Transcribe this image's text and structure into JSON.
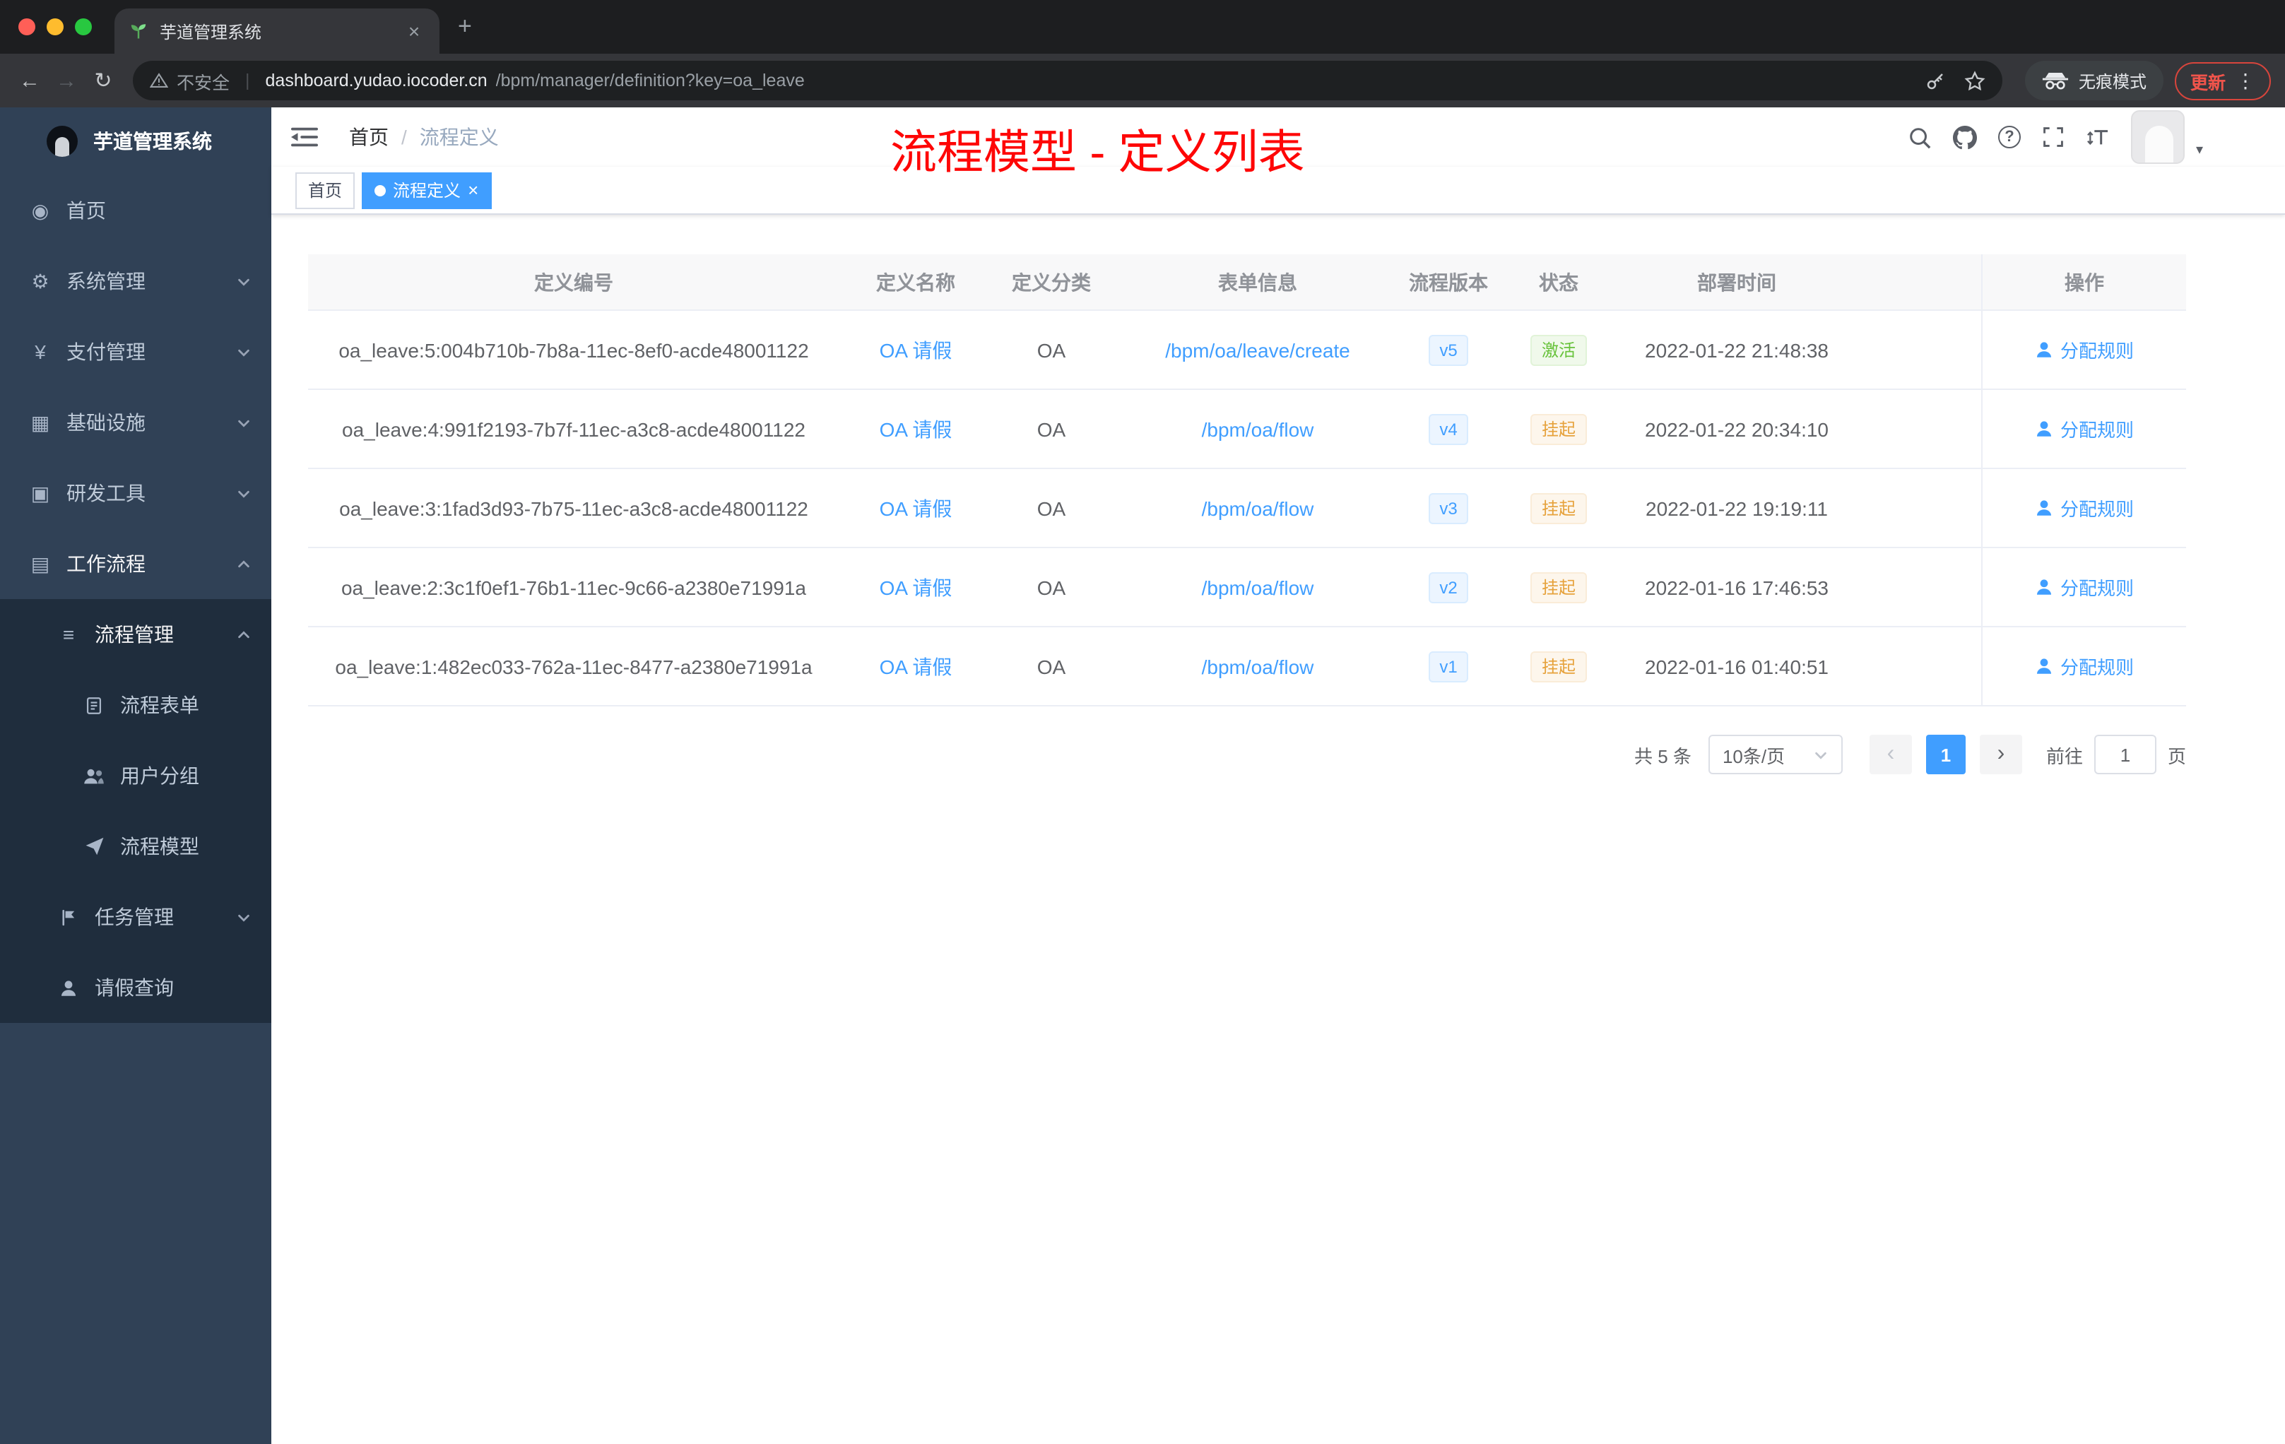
{
  "colors": {
    "accent": "#409eff",
    "success": "#67c23a",
    "warning": "#e6a23c",
    "overlay_red": "#fe0606",
    "sidebar_bg": "#304156",
    "sidebar_sub_bg": "#1f2d3d"
  },
  "browser": {
    "tab_title": "芋道管理系统",
    "security_label": "不安全",
    "url_host": "dashboard.yudao.iocoder.cn",
    "url_path": "/bpm/manager/definition?key=oa_leave",
    "incognito_label": "无痕模式",
    "update_label": "更新"
  },
  "icons": {
    "home": "◉",
    "settings": "⚙",
    "payment": "¥",
    "infrastructure": "▦",
    "devtools": "▣",
    "workflow": "▤",
    "process_mgmt": "≡",
    "close": "×",
    "new_tab": "+",
    "back": "←",
    "forward": "→",
    "reload": "↻",
    "dots": "⋮",
    "url_divider": "|",
    "caret_down": "▾",
    "help": "?",
    "prev": "‹",
    "next": "›"
  },
  "sidebar": {
    "logo_title": "芋道管理系统",
    "items": [
      {
        "label": "首页"
      },
      {
        "label": "系统管理"
      },
      {
        "label": "支付管理"
      },
      {
        "label": "基础设施"
      },
      {
        "label": "研发工具"
      },
      {
        "label": "工作流程"
      },
      {
        "label": "流程管理"
      },
      {
        "label": "流程表单"
      },
      {
        "label": "用户分组"
      },
      {
        "label": "流程模型"
      },
      {
        "label": "任务管理"
      },
      {
        "label": "请假查询"
      }
    ]
  },
  "header": {
    "breadcrumb_home": "首页",
    "breadcrumb_separator": "/",
    "breadcrumb_current": "流程定义",
    "overlay_title": "流程模型 - 定义列表"
  },
  "tags": [
    {
      "label": "首页"
    },
    {
      "label": "流程定义"
    }
  ],
  "table": {
    "columns": [
      "定义编号",
      "定义名称",
      "定义分类",
      "表单信息",
      "流程版本",
      "状态",
      "部署时间",
      "操作"
    ],
    "rows": [
      {
        "id": "oa_leave:5:004b710b-7b8a-11ec-8ef0-acde48001122",
        "name": "OA 请假",
        "category": "OA",
        "form": "/bpm/oa/leave/create",
        "version": "v5",
        "status": "激活",
        "status_type": "success",
        "time": "2022-01-22 21:48:38",
        "action": "分配规则"
      },
      {
        "id": "oa_leave:4:991f2193-7b7f-11ec-a3c8-acde48001122",
        "name": "OA 请假",
        "category": "OA",
        "form": "/bpm/oa/flow",
        "version": "v4",
        "status": "挂起",
        "status_type": "warning",
        "time": "2022-01-22 20:34:10",
        "action": "分配规则"
      },
      {
        "id": "oa_leave:3:1fad3d93-7b75-11ec-a3c8-acde48001122",
        "name": "OA 请假",
        "category": "OA",
        "form": "/bpm/oa/flow",
        "version": "v3",
        "status": "挂起",
        "status_type": "warning",
        "time": "2022-01-22 19:19:11",
        "action": "分配规则"
      },
      {
        "id": "oa_leave:2:3c1f0ef1-76b1-11ec-9c66-a2380e71991a",
        "name": "OA 请假",
        "category": "OA",
        "form": "/bpm/oa/flow",
        "version": "v2",
        "status": "挂起",
        "status_type": "warning",
        "time": "2022-01-16 17:46:53",
        "action": "分配规则"
      },
      {
        "id": "oa_leave:1:482ec033-762a-11ec-8477-a2380e71991a",
        "name": "OA 请假",
        "category": "OA",
        "form": "/bpm/oa/flow",
        "version": "v1",
        "status": "挂起",
        "status_type": "warning",
        "time": "2022-01-16 01:40:51",
        "action": "分配规则"
      }
    ]
  },
  "pagination": {
    "total_label": "共 5 条",
    "page_size_label": "10条/页",
    "current_page": "1",
    "goto_prefix": "前往",
    "goto_value": "1",
    "goto_suffix": "页"
  }
}
